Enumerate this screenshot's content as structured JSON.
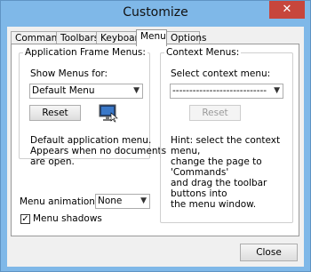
{
  "window": {
    "title": "Customize",
    "close_glyph": "✕"
  },
  "tabs": [
    {
      "label": "Commands"
    },
    {
      "label": "Toolbars"
    },
    {
      "label": "Keyboard"
    },
    {
      "label": "Menu"
    },
    {
      "label": "Options"
    }
  ],
  "app_frame": {
    "legend": "Application Frame Menus:",
    "show_label": "Show Menus for:",
    "select_value": "Default Menu",
    "reset_label": "Reset",
    "desc": [
      "Default application menu.",
      "Appears when no documents",
      "are open."
    ]
  },
  "context": {
    "legend": "Context Menus:",
    "select_label": "Select context menu:",
    "select_value": "----------------------------",
    "reset_label": "Reset",
    "hint": [
      "Hint: select the context menu,",
      "change the page to 'Commands'",
      "and drag the toolbar buttons into",
      "the menu window."
    ]
  },
  "animations": {
    "label": "Menu animations:",
    "value": "None"
  },
  "shadows": {
    "label": "Menu shadows",
    "checked": true,
    "check_glyph": "✓"
  },
  "footer": {
    "close_label": "Close"
  }
}
